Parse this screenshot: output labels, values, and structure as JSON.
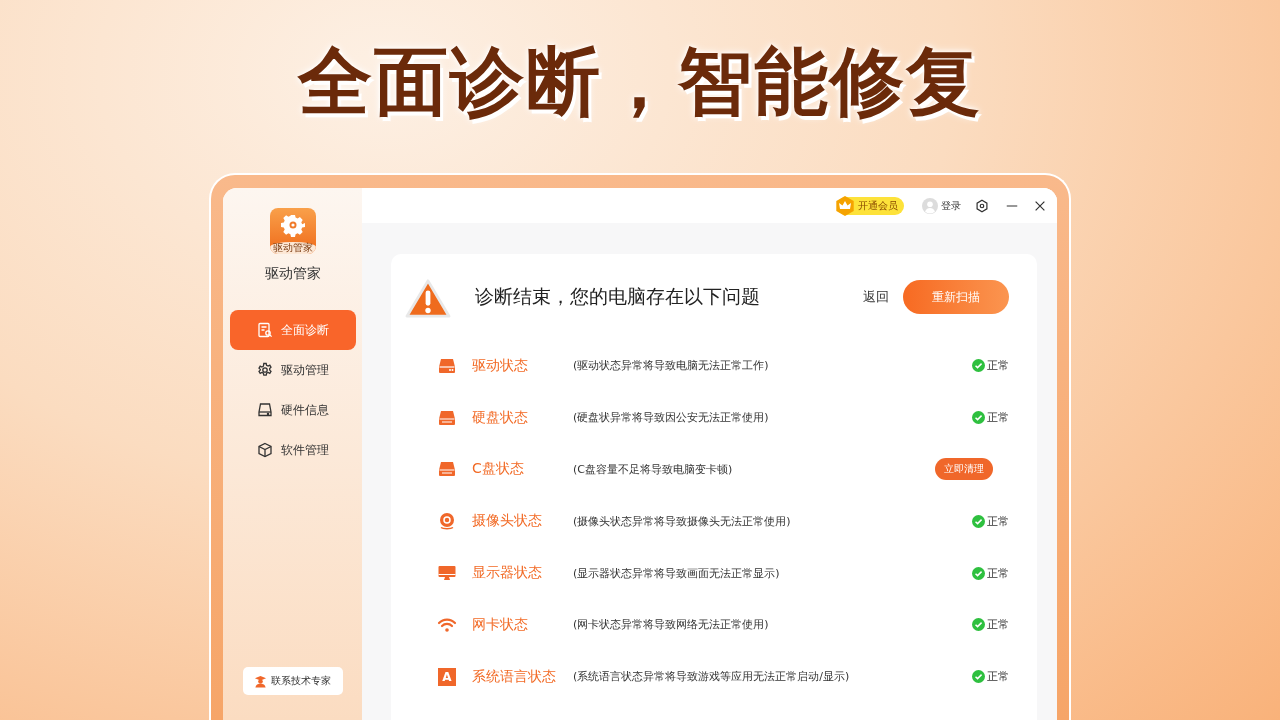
{
  "headline": "全面诊断，智能修复",
  "app": {
    "logo_caption": "驱动管家",
    "name": "驱动管家"
  },
  "sidebar": {
    "items": [
      {
        "label": "全面诊断",
        "selected": true
      },
      {
        "label": "驱动管理",
        "selected": false
      },
      {
        "label": "硬件信息",
        "selected": false
      },
      {
        "label": "软件管理",
        "selected": false
      }
    ],
    "contact_button": "联系技术专家"
  },
  "title_bar": {
    "vip_button": "开通会员",
    "login": "登录"
  },
  "report": {
    "title": "诊断结束，您的电脑存在以下问题",
    "back_link": "返回",
    "rescan_button": "重新扫描",
    "rows": [
      {
        "name": "驱动状态",
        "description": "(驱动状态异常将导致电脑无法正常工作)",
        "kind": "ok",
        "status": "正常"
      },
      {
        "name": "硬盘状态",
        "description": "(硬盘状异常将导致因公安无法正常使用)",
        "kind": "ok",
        "status": "正常"
      },
      {
        "name": "C盘状态",
        "description": "(C盘容量不足将导致电脑变卡顿)",
        "kind": "action",
        "action": "立即清理"
      },
      {
        "name": "摄像头状态",
        "description": "(摄像头状态异常将导致摄像头无法正常使用)",
        "kind": "ok",
        "status": "正常"
      },
      {
        "name": "显示器状态",
        "description": "(显示器状态异常将导致画面无法正常显示)",
        "kind": "ok",
        "status": "正常"
      },
      {
        "name": "网卡状态",
        "description": "(网卡状态异常将导致网络无法正常使用)",
        "kind": "ok",
        "status": "正常"
      },
      {
        "icon_label": "A",
        "name": "系统语言状态",
        "description": "(系统语言状态异常将导致游戏等应用无法正常启动/显示)",
        "kind": "ok",
        "status": "正常"
      }
    ]
  }
}
